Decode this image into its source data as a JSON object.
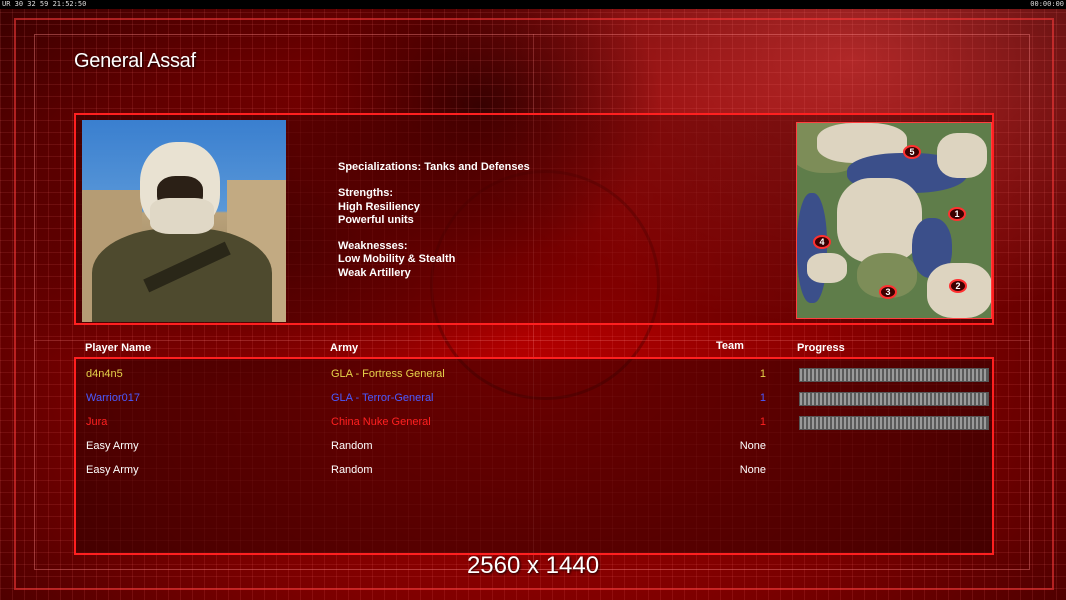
{
  "topbar": {
    "left_text": "UR 30 32 59 21:52:50",
    "right_text": "00:00:00"
  },
  "general_name": "General Assaf",
  "specs": {
    "specialization": "Specializations: Tanks and Defenses",
    "strengths_title": "Strengths:",
    "strengths": [
      "High Resiliency",
      "Powerful units"
    ],
    "weaknesses_title": "Weaknesses:",
    "weaknesses": [
      "Low Mobility & Stealth",
      "Weak Artillery"
    ]
  },
  "minimap": {
    "slots": [
      "1",
      "2",
      "3",
      "4",
      "5"
    ]
  },
  "table": {
    "headers": {
      "name": "Player Name",
      "army": "Army",
      "team": "Team",
      "progress": "Progress"
    },
    "rows": [
      {
        "name": "d4n4n5",
        "army": "GLA - Fortress General",
        "team": "1",
        "color": "#e6d24a",
        "progress": 1.0
      },
      {
        "name": "Warrior017",
        "army": "GLA - Terror-General",
        "team": "1",
        "color": "#4a5aff",
        "progress": 1.0
      },
      {
        "name": "Jura",
        "army": "China Nuke General",
        "team": "1",
        "color": "#ff2020",
        "progress": 1.0
      },
      {
        "name": "Easy Army",
        "army": "Random",
        "team": "None",
        "color": "#ffffff"
      },
      {
        "name": "Easy Army",
        "army": "Random",
        "team": "None",
        "color": "#ffffff"
      }
    ]
  },
  "resolution_label": "2560 x 1440",
  "colors": {
    "accent": "#ff2020",
    "background": "#7a0000"
  }
}
